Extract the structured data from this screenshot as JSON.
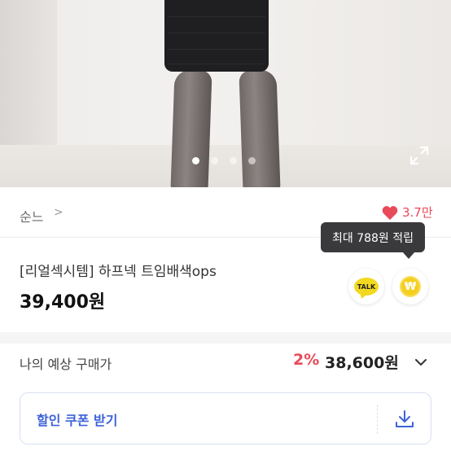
{
  "hero": {
    "slide_count": 4,
    "active_slide": 1
  },
  "seller": {
    "name": "순느",
    "arrow": ">"
  },
  "like": {
    "count": "3.7만"
  },
  "tooltip": {
    "text": "최대 788원 적립"
  },
  "product": {
    "title": "[리얼섹시템] 하프넥 트임배색ops",
    "price": "39,400원"
  },
  "actions": {
    "talk_label": "TALK",
    "point_symbol": "₩"
  },
  "expected": {
    "label": "나의 예상 구매가",
    "rate": "2%",
    "price": "38,600원"
  },
  "coupon": {
    "label": "할인 쿠폰 받기"
  },
  "colors": {
    "accent_red": "#e84a5a",
    "coupon_blue": "#3d63d8",
    "kakao_yellow": "#f2d81f"
  }
}
